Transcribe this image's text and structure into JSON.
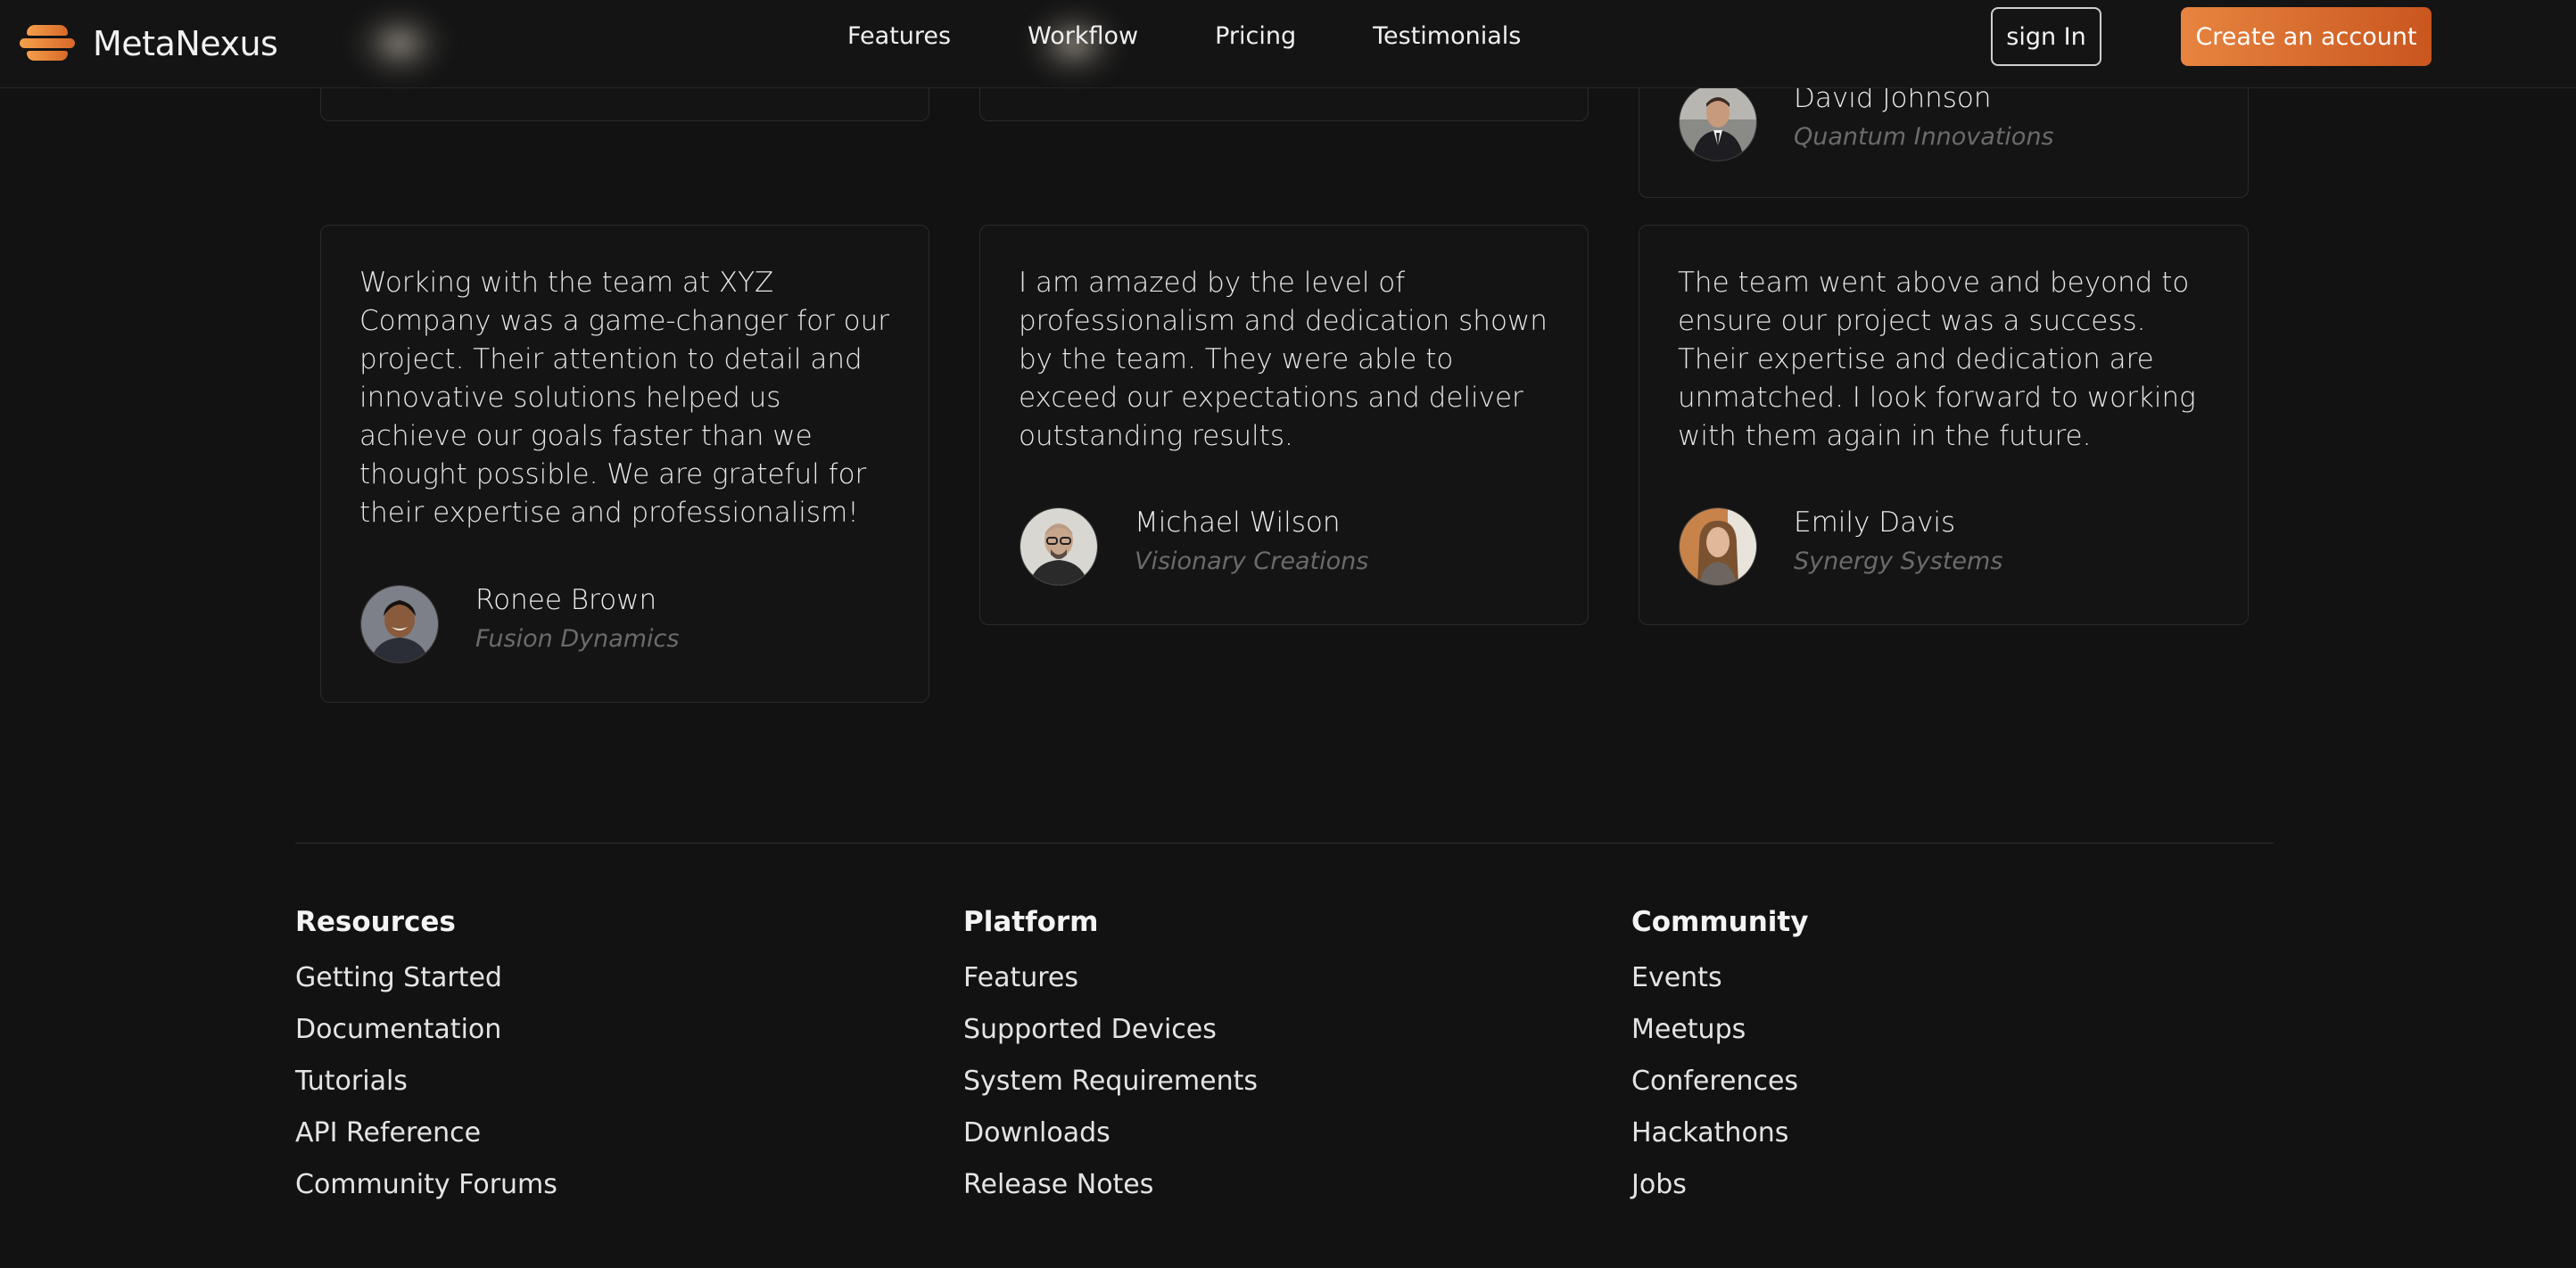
{
  "header": {
    "brand": "MetaNexus",
    "nav": [
      "Features",
      "Workflow",
      "Pricing",
      "Testimonials"
    ],
    "signin_label": "sign In",
    "create_label": "Create an account"
  },
  "top_partial": {
    "name": "David Johnson",
    "company": "Quantum Innovations"
  },
  "testimonials": [
    {
      "quote": "Working with the team at XYZ Company was a game-changer for our project. Their attention to detail and innovative solutions helped us achieve our goals faster than we thought possible. We are grateful for their expertise and professionalism!",
      "name": "Ronee Brown",
      "company": "Fusion Dynamics"
    },
    {
      "quote": "I am amazed by the level of professionalism and dedication shown by the team. They were able to exceed our expectations and deliver outstanding results.",
      "name": "Michael Wilson",
      "company": "Visionary Creations"
    },
    {
      "quote": "The team went above and beyond to ensure our project was a success. Their expertise and dedication are unmatched. I look forward to working with them again in the future.",
      "name": "Emily Davis",
      "company": "Synergy Systems"
    }
  ],
  "footer": {
    "columns": [
      {
        "title": "Resources",
        "links": [
          "Getting Started",
          "Documentation",
          "Tutorials",
          "API Reference",
          "Community Forums"
        ]
      },
      {
        "title": "Platform",
        "links": [
          "Features",
          "Supported Devices",
          "System Requirements",
          "Downloads",
          "Release Notes"
        ]
      },
      {
        "title": "Community",
        "links": [
          "Events",
          "Meetups",
          "Conferences",
          "Hackathons",
          "Jobs"
        ]
      }
    ]
  },
  "colors": {
    "background": "#121212",
    "accent": "#e7843f",
    "muted_text": "#6b6b6b"
  }
}
